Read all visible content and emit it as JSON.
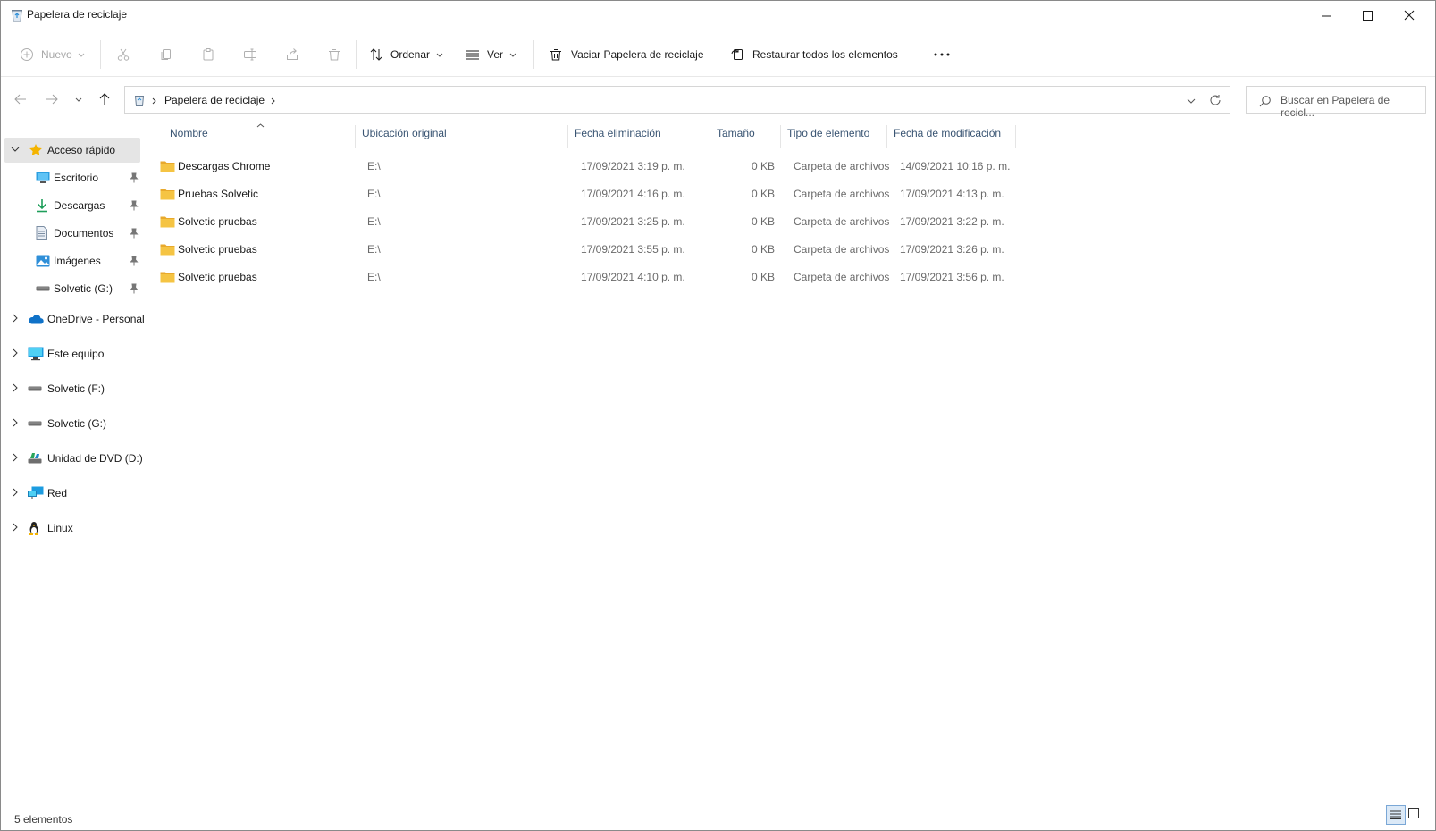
{
  "window": {
    "title": "Papelera de reciclaje"
  },
  "toolbar": {
    "new_label": "Nuevo",
    "sort_label": "Ordenar",
    "view_label": "Ver",
    "empty_label": "Vaciar Papelera de reciclaje",
    "restore_label": "Restaurar todos los elementos",
    "more_label": "···"
  },
  "address": {
    "crumb": "Papelera de reciclaje",
    "search_placeholder": "Buscar en Papelera de recicl..."
  },
  "sidebar": {
    "quick_access": "Acceso rápido",
    "pinned": [
      {
        "label": "Escritorio",
        "icon": "desktop-icon"
      },
      {
        "label": "Descargas",
        "icon": "download-icon"
      },
      {
        "label": "Documentos",
        "icon": "document-icon"
      },
      {
        "label": "Imágenes",
        "icon": "pictures-icon"
      },
      {
        "label": "Solvetic (G:)",
        "icon": "drive-icon"
      }
    ],
    "roots": [
      {
        "label": "OneDrive - Personal",
        "icon": "cloud-icon"
      },
      {
        "label": "Este equipo",
        "icon": "monitor-icon"
      },
      {
        "label": "Solvetic (F:)",
        "icon": "drive-icon"
      },
      {
        "label": "Solvetic (G:)",
        "icon": "drive-icon"
      },
      {
        "label": "Unidad de DVD (D:)",
        "icon": "dvd-icon"
      },
      {
        "label": "Red",
        "icon": "network-icon"
      },
      {
        "label": "Linux",
        "icon": "linux-icon"
      }
    ]
  },
  "columns": {
    "name": "Nombre",
    "location": "Ubicación original",
    "deleted": "Fecha eliminación",
    "size": "Tamaño",
    "type": "Tipo de elemento",
    "modified": "Fecha de modificación"
  },
  "files": [
    {
      "name": "Descargas Chrome",
      "location": "E:\\",
      "deleted": "17/09/2021 3:19 p. m.",
      "size": "0 KB",
      "type": "Carpeta de archivos",
      "modified": "14/09/2021 10:16 p. m."
    },
    {
      "name": "Pruebas Solvetic",
      "location": "E:\\",
      "deleted": "17/09/2021 4:16 p. m.",
      "size": "0 KB",
      "type": "Carpeta de archivos",
      "modified": "17/09/2021 4:13 p. m."
    },
    {
      "name": "Solvetic pruebas",
      "location": "E:\\",
      "deleted": "17/09/2021 3:25 p. m.",
      "size": "0 KB",
      "type": "Carpeta de archivos",
      "modified": "17/09/2021 3:22 p. m."
    },
    {
      "name": "Solvetic pruebas",
      "location": "E:\\",
      "deleted": "17/09/2021 3:55 p. m.",
      "size": "0 KB",
      "type": "Carpeta de archivos",
      "modified": "17/09/2021 3:26 p. m."
    },
    {
      "name": "Solvetic pruebas",
      "location": "E:\\",
      "deleted": "17/09/2021 4:10 p. m.",
      "size": "0 KB",
      "type": "Carpeta de archivos",
      "modified": "17/09/2021 3:56 p. m."
    }
  ],
  "status": {
    "count": "5 elementos"
  },
  "colors": {
    "folder": "#f5c443",
    "star": "#f4b400",
    "accent": "#0067c0",
    "header_text": "#3a5573"
  }
}
